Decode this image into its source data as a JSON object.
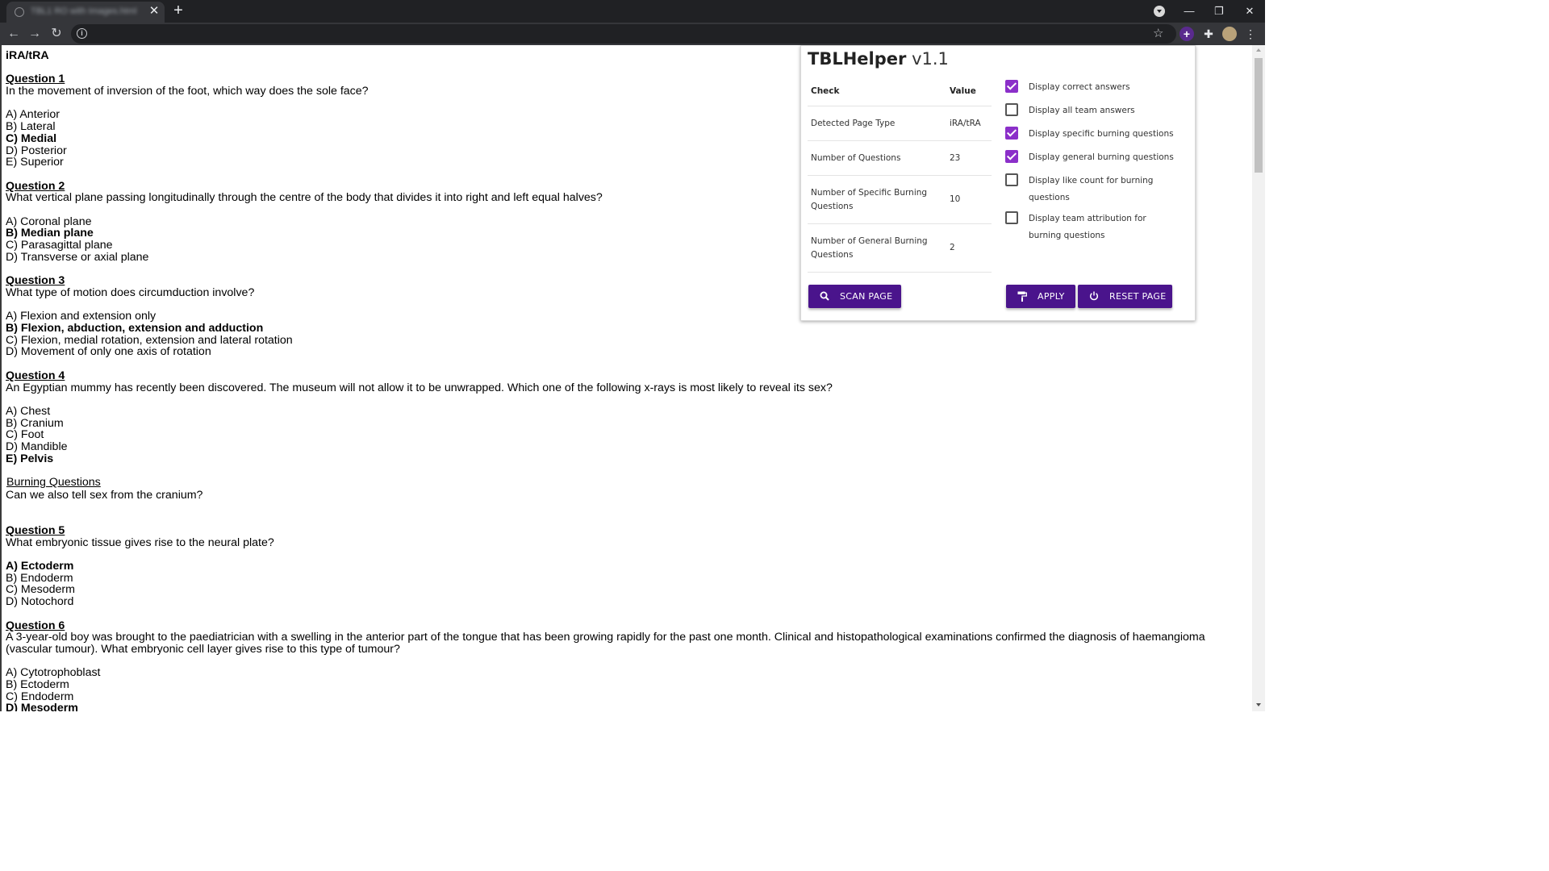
{
  "browser": {
    "tab_title": "TBL1 RO with Images.html",
    "close_glyph": "✕",
    "new_tab_glyph": "+",
    "window": {
      "minimize": "—",
      "restore": "❐",
      "close": "✕"
    },
    "nav": {
      "back": "←",
      "forward": "→",
      "reload": "↻"
    },
    "info_glyph": "i",
    "star_glyph": "☆",
    "ext_glyph": "+",
    "puzzle_glyph": "✚",
    "kebab_glyph": "⋮"
  },
  "page": {
    "heading": "iRA/tRA",
    "questions": [
      {
        "title": "Question 1",
        "text": "In the movement of inversion of the foot, which way does the sole face?",
        "options": [
          "A) Anterior",
          "B) Lateral",
          "C) Medial",
          "D) Posterior",
          "E) Superior"
        ],
        "correct": 2
      },
      {
        "title": "Question 2",
        "text": "What vertical plane passing longitudinally through the centre of the body that divides it into right and left equal halves?",
        "options": [
          "A) Coronal plane",
          "B) Median plane",
          "C) Parasagittal plane",
          "D) Transverse or axial plane"
        ],
        "correct": 1
      },
      {
        "title": "Question 3",
        "text": "What type of motion does circumduction involve?",
        "options": [
          "A) Flexion and extension only",
          "B) Flexion, abduction, extension and adduction",
          "C) Flexion, medial rotation, extension and lateral rotation",
          "D) Movement of only one axis of rotation"
        ],
        "correct": 1
      },
      {
        "title": "Question 4",
        "text": "An Egyptian mummy has recently been discovered. The museum will not allow it to be unwrapped. Which one of the following x-rays is most likely to reveal its sex?",
        "options": [
          "A) Chest",
          "B) Cranium",
          "C) Foot",
          "D) Mandible",
          "E) Pelvis"
        ],
        "correct": 4,
        "burning_title": "Burning Questions",
        "burning_text": "Can we also tell sex from the cranium?"
      },
      {
        "title": "Question 5",
        "text": "What embryonic tissue gives rise to the neural plate?",
        "options": [
          "A) Ectoderm",
          "B) Endoderm",
          "C) Mesoderm",
          "D) Notochord"
        ],
        "correct": 0
      },
      {
        "title": "Question 6",
        "text": "A 3-year-old boy was brought to the paediatrician with a swelling in the anterior part of the tongue that has been growing rapidly for the past one month. Clinical and histopathological examinations confirmed the diagnosis of haemangioma (vascular tumour). What embryonic cell layer gives rise to this type of tumour?",
        "options": [
          "A) Cytotrophoblast",
          "B) Ectoderm",
          "C) Endoderm",
          "D) Mesoderm"
        ],
        "correct": 3
      }
    ]
  },
  "popup": {
    "name": "TBLHelper",
    "version": "v1.1",
    "table": {
      "header_check": "Check",
      "header_value": "Value",
      "rows": [
        {
          "check": "Detected Page Type",
          "value": "iRA/tRA"
        },
        {
          "check": "Number of Questions",
          "value": "23"
        },
        {
          "check": "Number of Specific Burning Questions",
          "value": "10"
        },
        {
          "check": "Number of General Burning Questions",
          "value": "2"
        }
      ]
    },
    "options": [
      {
        "label": "Display correct answers",
        "checked": true
      },
      {
        "label": "Display all team answers",
        "checked": false
      },
      {
        "label": "Display specific burning questions",
        "checked": true
      },
      {
        "label": "Display general burning questions",
        "checked": true
      },
      {
        "label": "Display like count for burning questions",
        "checked": false
      },
      {
        "label": "Display team attribution for burning questions",
        "checked": false
      }
    ],
    "buttons": {
      "scan": "SCAN PAGE",
      "apply": "APPLY",
      "reset": "RESET PAGE"
    },
    "icons": {
      "scan": "search-icon",
      "apply": "paint-roller-icon",
      "reset": "power-icon"
    },
    "accent_color": "#4a148c",
    "checkbox_color": "#8b2fc9"
  }
}
